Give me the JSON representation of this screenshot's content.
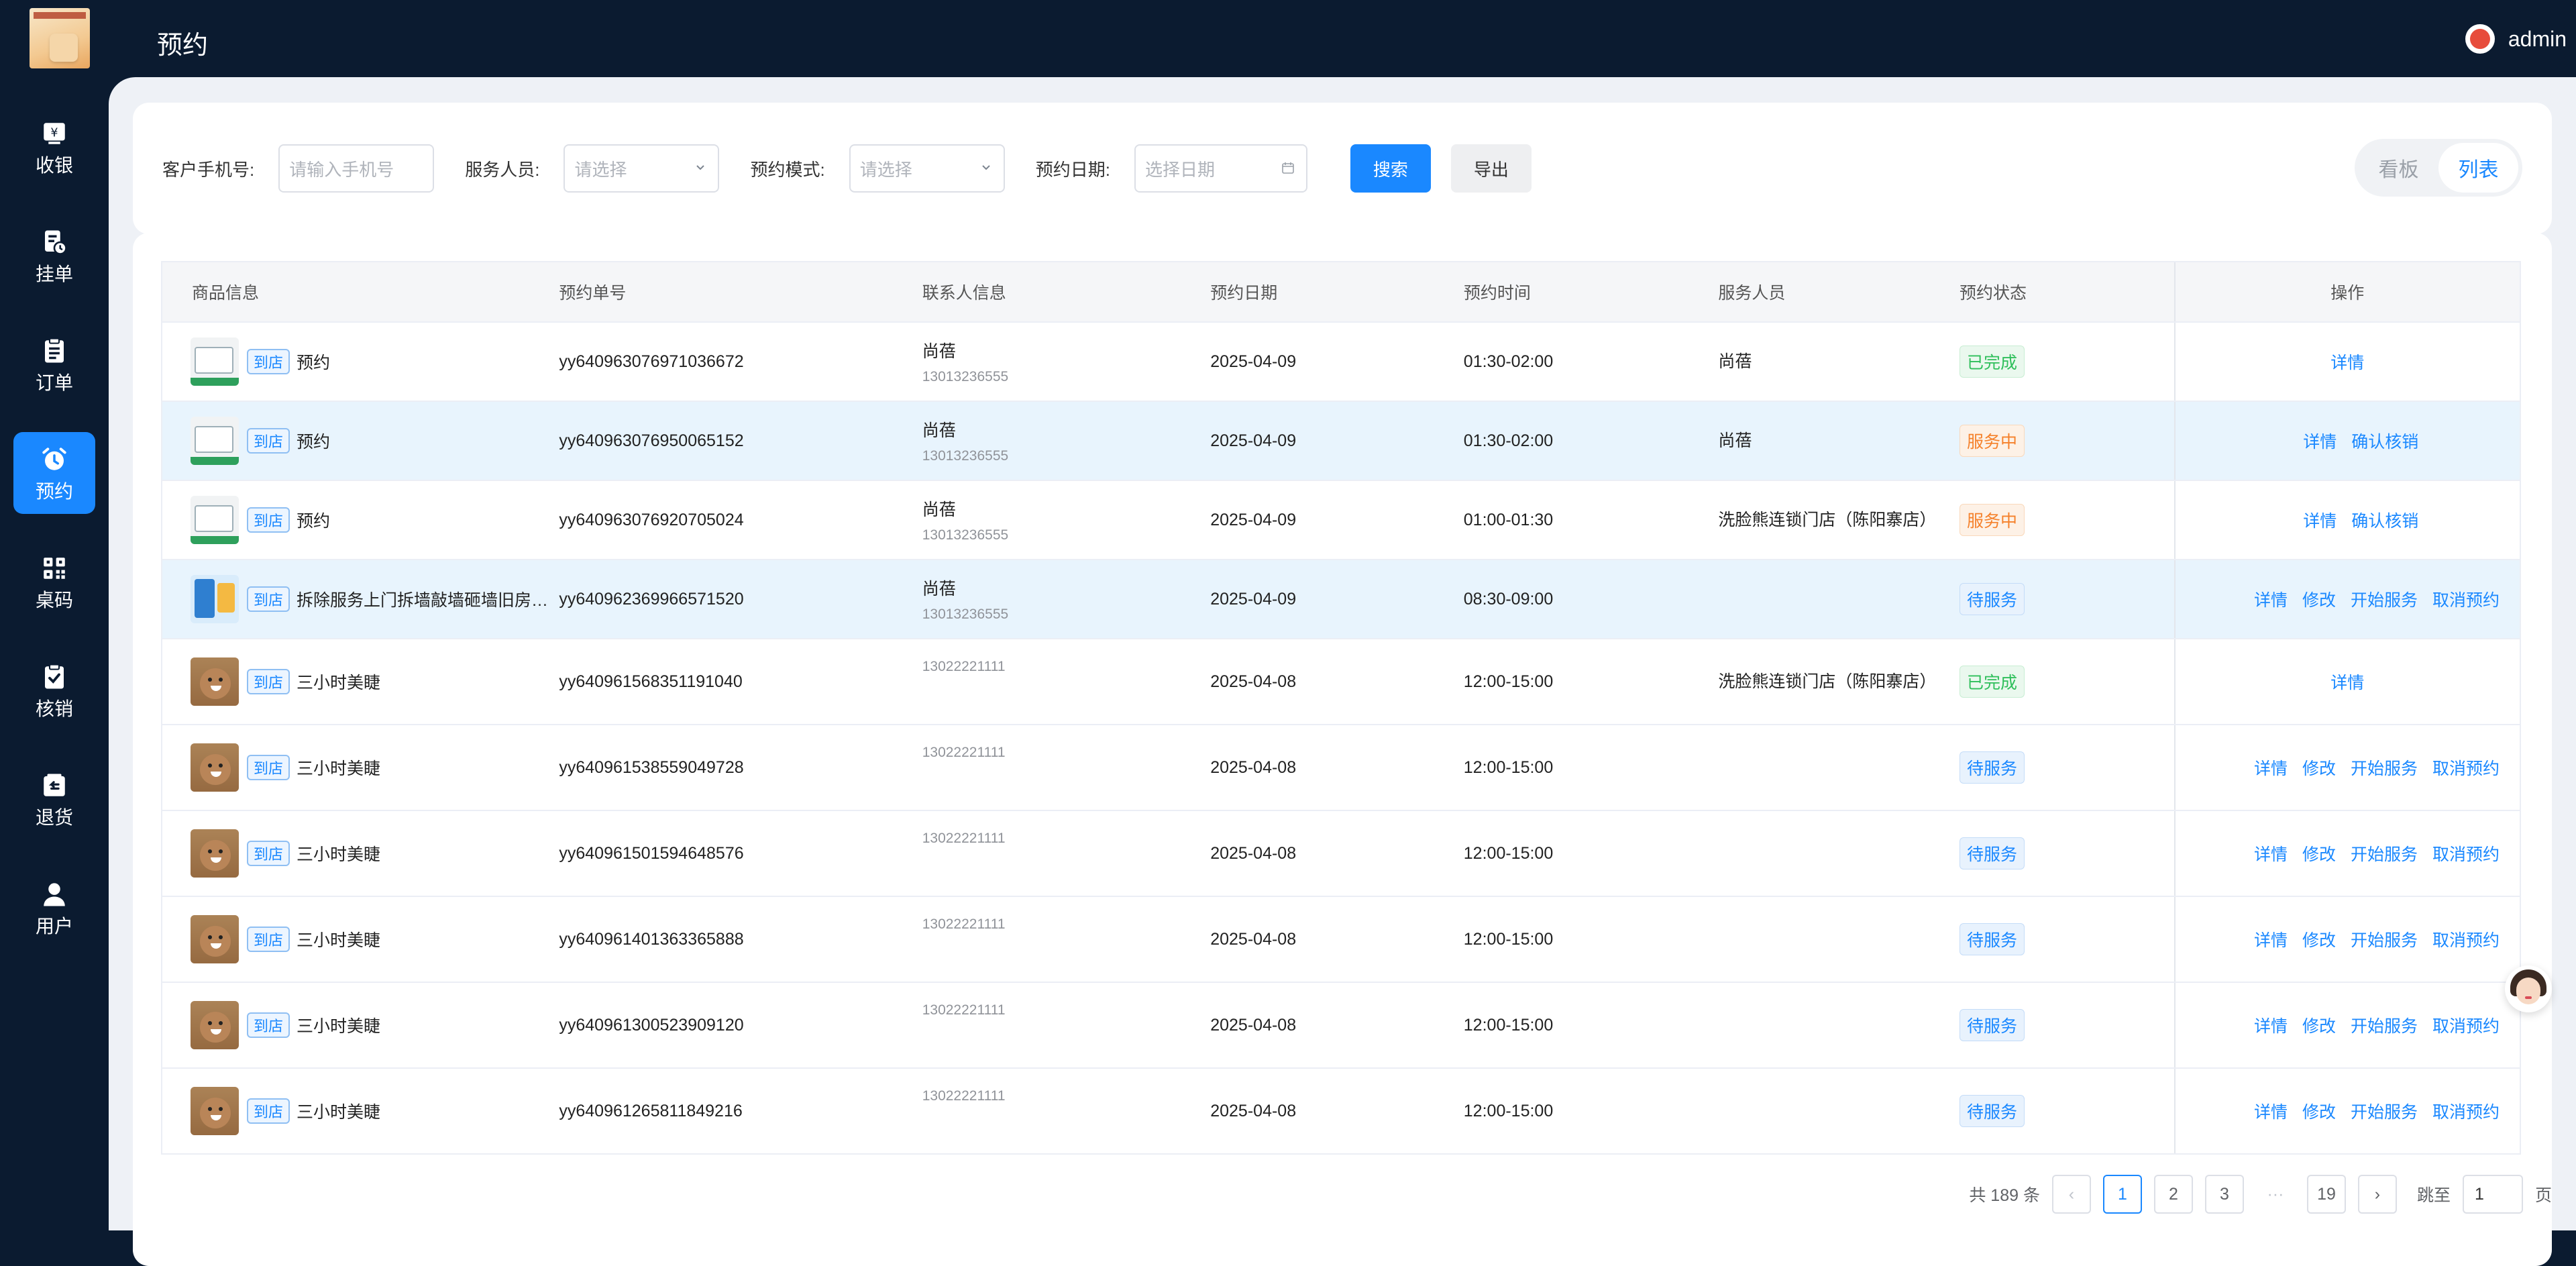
{
  "app": {
    "page_title": "预约",
    "user_name": "admin"
  },
  "sidebar": {
    "items": [
      {
        "label": "收银",
        "icon": "cashier-icon"
      },
      {
        "label": "挂单",
        "icon": "pending-order-icon"
      },
      {
        "label": "订单",
        "icon": "order-icon"
      },
      {
        "label": "预约",
        "icon": "alarm-clock-icon",
        "active": true
      },
      {
        "label": "桌码",
        "icon": "qr-code-icon"
      },
      {
        "label": "核销",
        "icon": "verify-icon"
      },
      {
        "label": "退货",
        "icon": "return-icon"
      },
      {
        "label": "用户",
        "icon": "user-icon"
      }
    ]
  },
  "filters": {
    "phone_label": "客户手机号:",
    "phone_placeholder": "请输入手机号",
    "staff_label": "服务人员:",
    "staff_placeholder": "请选择",
    "mode_label": "预约模式:",
    "mode_placeholder": "请选择",
    "date_label": "预约日期:",
    "date_placeholder": "选择日期",
    "search_label": "搜索",
    "export_label": "导出"
  },
  "view_toggle": {
    "board": "看板",
    "list": "列表",
    "active": "列表"
  },
  "table": {
    "columns": [
      "商品信息",
      "预约单号",
      "联系人信息",
      "预约日期",
      "预约时间",
      "服务人员",
      "预约状态",
      "操作"
    ],
    "rows": [
      {
        "thumb": "promo",
        "tag": "到店",
        "product": "预约",
        "order_no": "yy640963076971036672",
        "contact_name": "尚蓓",
        "contact_phone": "13013236555",
        "date": "2025-04-09",
        "time": "01:30-02:00",
        "staff": "尚蓓",
        "status": "已完成",
        "status_type": "done",
        "actions": [
          "详情"
        ]
      },
      {
        "thumb": "promo",
        "tag": "到店",
        "product": "预约",
        "order_no": "yy640963076950065152",
        "contact_name": "尚蓓",
        "contact_phone": "13013236555",
        "date": "2025-04-09",
        "time": "01:30-02:00",
        "staff": "尚蓓",
        "status": "服务中",
        "status_type": "serving",
        "actions": [
          "详情",
          "确认核销"
        ],
        "highlight": true
      },
      {
        "thumb": "promo",
        "tag": "到店",
        "product": "预约",
        "order_no": "yy640963076920705024",
        "contact_name": "尚蓓",
        "contact_phone": "13013236555",
        "date": "2025-04-09",
        "time": "01:00-01:30",
        "staff": "洗脸熊连锁门店（陈阳寨店）",
        "status": "服务中",
        "status_type": "serving",
        "actions": [
          "详情",
          "确认核销"
        ]
      },
      {
        "thumb": "demo",
        "tag": "到店",
        "product": "拆除服务上门拆墙敲墙砸墙旧房…",
        "order_no": "yy640962369966571520",
        "contact_name": "尚蓓",
        "contact_phone": "13013236555",
        "date": "2025-04-09",
        "time": "08:30-09:00",
        "staff": "",
        "status": "待服务",
        "status_type": "wait",
        "actions": [
          "详情",
          "修改",
          "开始服务",
          "取消预约"
        ],
        "highlight": true
      },
      {
        "thumb": "bear",
        "tag": "到店",
        "product": "三小时美睫",
        "order_no": "yy640961568351191040",
        "contact_name": "",
        "contact_phone": "13022221111",
        "date": "2025-04-08",
        "time": "12:00-15:00",
        "staff": "洗脸熊连锁门店（陈阳寨店）",
        "status": "已完成",
        "status_type": "done",
        "actions": [
          "详情"
        ]
      },
      {
        "thumb": "bear",
        "tag": "到店",
        "product": "三小时美睫",
        "order_no": "yy640961538559049728",
        "contact_name": "",
        "contact_phone": "13022221111",
        "date": "2025-04-08",
        "time": "12:00-15:00",
        "staff": "",
        "status": "待服务",
        "status_type": "wait",
        "actions": [
          "详情",
          "修改",
          "开始服务",
          "取消预约"
        ]
      },
      {
        "thumb": "bear",
        "tag": "到店",
        "product": "三小时美睫",
        "order_no": "yy640961501594648576",
        "contact_name": "",
        "contact_phone": "13022221111",
        "date": "2025-04-08",
        "time": "12:00-15:00",
        "staff": "",
        "status": "待服务",
        "status_type": "wait",
        "actions": [
          "详情",
          "修改",
          "开始服务",
          "取消预约"
        ]
      },
      {
        "thumb": "bear",
        "tag": "到店",
        "product": "三小时美睫",
        "order_no": "yy640961401363365888",
        "contact_name": "",
        "contact_phone": "13022221111",
        "date": "2025-04-08",
        "time": "12:00-15:00",
        "staff": "",
        "status": "待服务",
        "status_type": "wait",
        "actions": [
          "详情",
          "修改",
          "开始服务",
          "取消预约"
        ]
      },
      {
        "thumb": "bear",
        "tag": "到店",
        "product": "三小时美睫",
        "order_no": "yy640961300523909120",
        "contact_name": "",
        "contact_phone": "13022221111",
        "date": "2025-04-08",
        "time": "12:00-15:00",
        "staff": "",
        "status": "待服务",
        "status_type": "wait",
        "actions": [
          "详情",
          "修改",
          "开始服务",
          "取消预约"
        ]
      },
      {
        "thumb": "bear",
        "tag": "到店",
        "product": "三小时美睫",
        "order_no": "yy640961265811849216",
        "contact_name": "",
        "contact_phone": "13022221111",
        "date": "2025-04-08",
        "time": "12:00-15:00",
        "staff": "",
        "status": "待服务",
        "status_type": "wait",
        "actions": [
          "详情",
          "修改",
          "开始服务",
          "取消预约"
        ]
      }
    ]
  },
  "pagination": {
    "total_text": "共 189 条",
    "pages": [
      "1",
      "2",
      "3"
    ],
    "ellipsis": "···",
    "last_page": "19",
    "current": "1",
    "jump_label": "跳至",
    "jump_value": "1",
    "page_suffix": "页",
    "prev": "‹",
    "next": "›"
  },
  "colors": {
    "primary": "#1a88ff",
    "sidebar_bg": "#0b1b30",
    "done": "#2fbf5b",
    "serving": "#f5812b",
    "wait": "#1a88ff"
  }
}
